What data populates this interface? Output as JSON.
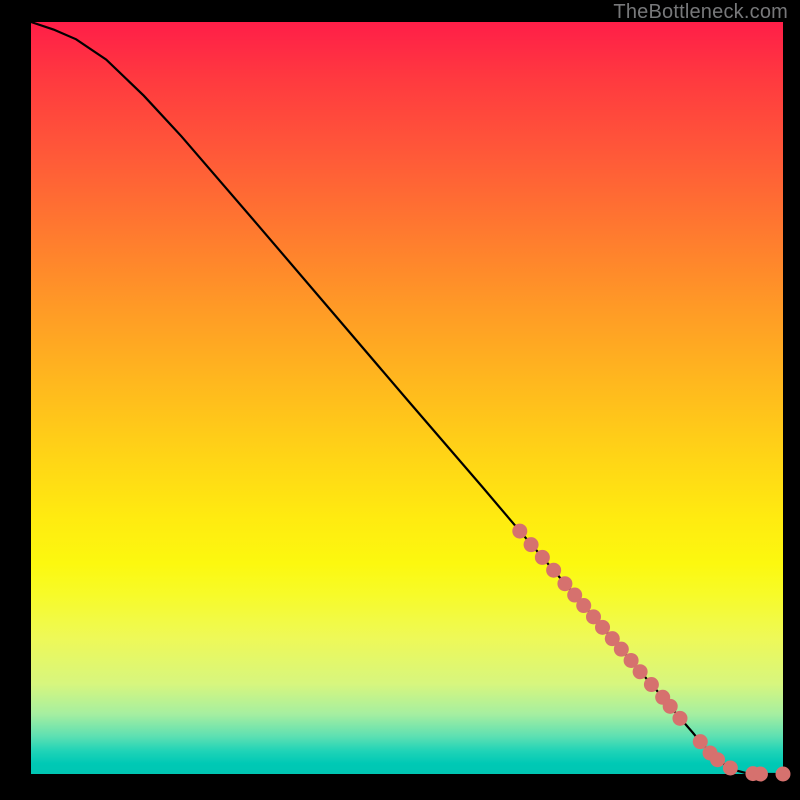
{
  "watermark": "TheBottleneck.com",
  "colors": {
    "line": "#000000",
    "marker": "#d6716e"
  },
  "chart_data": {
    "type": "line",
    "title": "",
    "xlabel": "",
    "ylabel": "",
    "xlim": [
      0,
      100
    ],
    "ylim": [
      0,
      100
    ],
    "grid": false,
    "curve_points": [
      {
        "x": 0,
        "y": 100
      },
      {
        "x": 3,
        "y": 99
      },
      {
        "x": 6,
        "y": 97.7
      },
      {
        "x": 10,
        "y": 95
      },
      {
        "x": 15,
        "y": 90.2
      },
      {
        "x": 20,
        "y": 84.8
      },
      {
        "x": 30,
        "y": 73.2
      },
      {
        "x": 40,
        "y": 61.5
      },
      {
        "x": 50,
        "y": 49.8
      },
      {
        "x": 60,
        "y": 38.2
      },
      {
        "x": 65,
        "y": 32.3
      },
      {
        "x": 70,
        "y": 26.5
      },
      {
        "x": 75,
        "y": 20.7
      },
      {
        "x": 80,
        "y": 14.8
      },
      {
        "x": 82,
        "y": 12.5
      },
      {
        "x": 84,
        "y": 10.2
      },
      {
        "x": 86,
        "y": 7.8
      },
      {
        "x": 88,
        "y": 5.5
      },
      {
        "x": 89,
        "y": 4.3
      },
      {
        "x": 90,
        "y": 3.2
      },
      {
        "x": 91,
        "y": 2.2
      },
      {
        "x": 92,
        "y": 1.4
      },
      {
        "x": 93,
        "y": 0.8
      },
      {
        "x": 94,
        "y": 0.4
      },
      {
        "x": 95,
        "y": 0.15
      },
      {
        "x": 97,
        "y": 0.0
      },
      {
        "x": 100,
        "y": 0.0
      }
    ],
    "markers": [
      {
        "x": 65,
        "y": 32.3
      },
      {
        "x": 66.5,
        "y": 30.5
      },
      {
        "x": 68,
        "y": 28.8
      },
      {
        "x": 69.5,
        "y": 27.1
      },
      {
        "x": 71,
        "y": 25.3
      },
      {
        "x": 72.3,
        "y": 23.8
      },
      {
        "x": 73.5,
        "y": 22.4
      },
      {
        "x": 74.8,
        "y": 20.9
      },
      {
        "x": 76,
        "y": 19.5
      },
      {
        "x": 77.3,
        "y": 18.0
      },
      {
        "x": 78.5,
        "y": 16.6
      },
      {
        "x": 79.8,
        "y": 15.1
      },
      {
        "x": 81,
        "y": 13.6
      },
      {
        "x": 82.5,
        "y": 11.9
      },
      {
        "x": 84,
        "y": 10.2
      },
      {
        "x": 85,
        "y": 9.0
      },
      {
        "x": 86.3,
        "y": 7.4
      },
      {
        "x": 89,
        "y": 4.3
      },
      {
        "x": 90.3,
        "y": 2.8
      },
      {
        "x": 91.3,
        "y": 1.9
      },
      {
        "x": 93,
        "y": 0.8
      },
      {
        "x": 96,
        "y": 0.05
      },
      {
        "x": 97,
        "y": 0.0
      },
      {
        "x": 100,
        "y": 0.0
      }
    ]
  }
}
